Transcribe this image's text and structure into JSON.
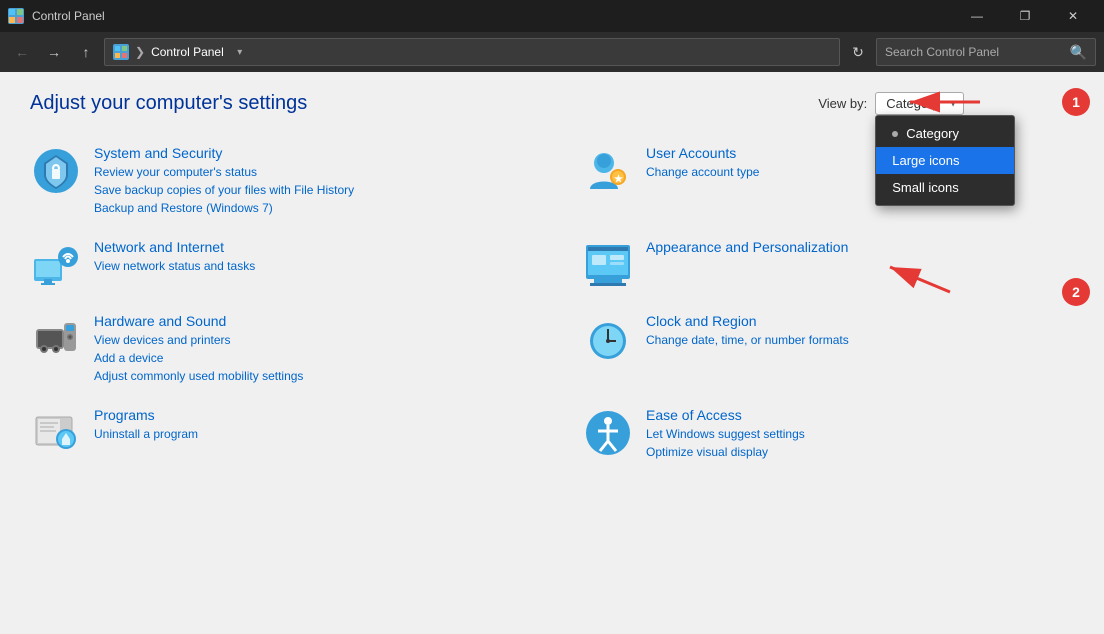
{
  "titlebar": {
    "icon": "CP",
    "title": "Control Panel",
    "minimize_label": "—",
    "restore_label": "❐",
    "close_label": "✕"
  },
  "addressbar": {
    "icon_label": "CP",
    "breadcrumb_root": "Control Panel",
    "dropdown_arrow": "▾",
    "refresh_icon": "↻",
    "search_placeholder": "Search Control Panel",
    "search_icon": "🔍"
  },
  "page": {
    "title": "Adjust your computer's settings",
    "viewby_label": "View by:",
    "viewby_value": "Category",
    "dropdown_items": [
      {
        "label": "Category",
        "selected": false,
        "has_dot": true
      },
      {
        "label": "Large icons",
        "selected": true,
        "has_dot": false
      },
      {
        "label": "Small icons",
        "selected": false,
        "has_dot": false
      }
    ]
  },
  "categories": [
    {
      "id": "system-security",
      "title": "System and Security",
      "links": [
        "Review your computer's status",
        "Save backup copies of your files with File History",
        "Backup and Restore (Windows 7)"
      ]
    },
    {
      "id": "user-accounts",
      "title": "User Accounts",
      "links": [
        "Change account type"
      ]
    },
    {
      "id": "network-internet",
      "title": "Network and Internet",
      "links": [
        "View network status and tasks"
      ]
    },
    {
      "id": "appearance",
      "title": "Appearance and Personalization",
      "links": []
    },
    {
      "id": "hardware-sound",
      "title": "Hardware and Sound",
      "links": [
        "View devices and printers",
        "Add a device",
        "Adjust commonly used mobility settings"
      ]
    },
    {
      "id": "clock-region",
      "title": "Clock and Region",
      "links": [
        "Change date, time, or number formats"
      ]
    },
    {
      "id": "programs",
      "title": "Programs",
      "links": [
        "Uninstall a program"
      ]
    },
    {
      "id": "ease-of-access",
      "title": "Ease of Access",
      "links": [
        "Let Windows suggest settings",
        "Optimize visual display"
      ]
    }
  ],
  "annotations": {
    "num1": "1",
    "num2": "2"
  }
}
